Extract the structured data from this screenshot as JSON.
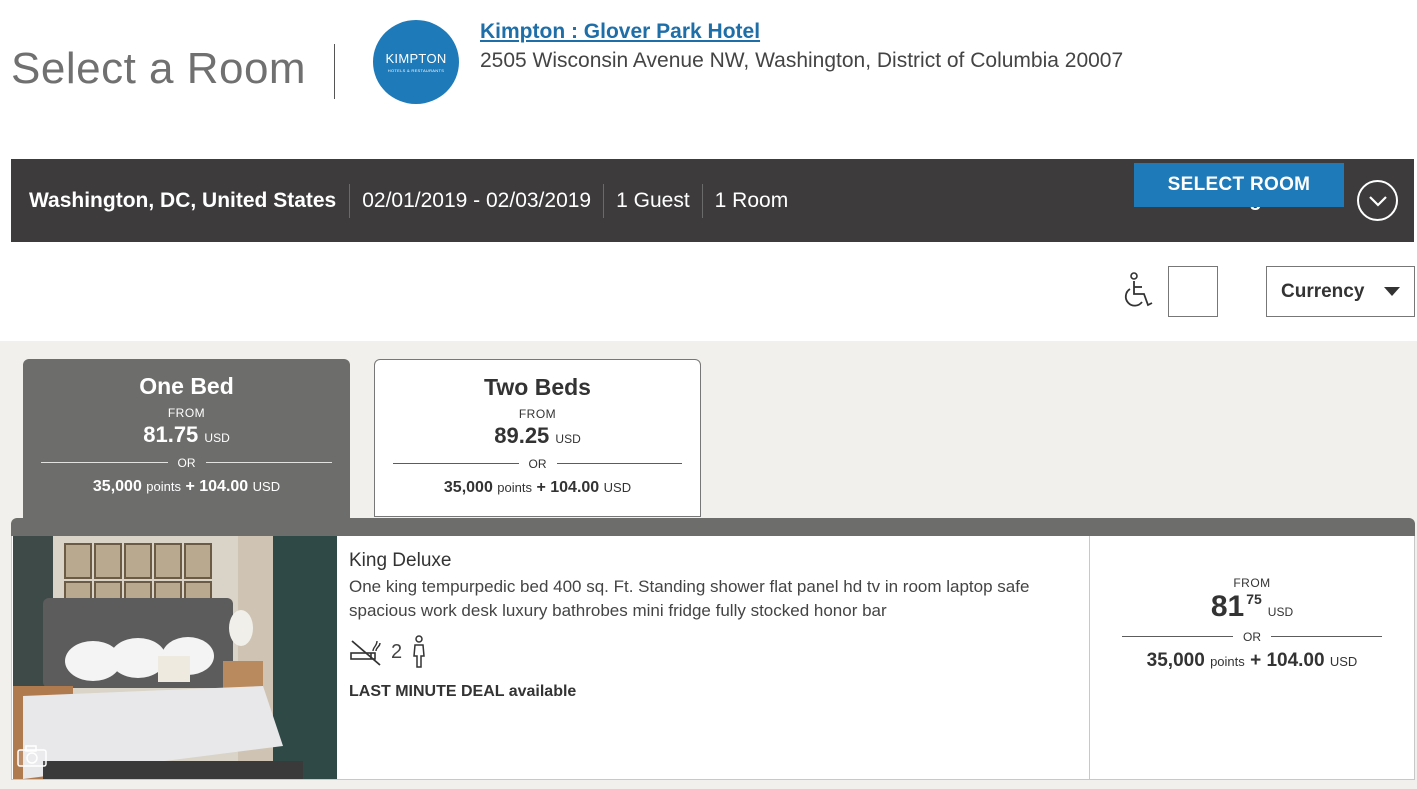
{
  "header": {
    "page_title": "Select a Room",
    "logo_brand": "KIMPTON",
    "logo_sub": "HOTELS & RESTAURANTS",
    "hotel_name": "Kimpton : Glover Park Hotel",
    "hotel_address": "2505 Wisconsin Avenue NW, Washington, District of Columbia 20007"
  },
  "search": {
    "location": "Washington, DC, United States",
    "dates": "02/01/2019 - 02/03/2019",
    "guests": "1 Guest",
    "rooms": "1 Room",
    "change_label": "Change Search"
  },
  "filters": {
    "accessible_icon": "wheelchair-icon",
    "currency_label": "Currency"
  },
  "bed_tabs": [
    {
      "title": "One Bed",
      "from_label": "FROM",
      "price": "81.75",
      "currency": "USD",
      "or_label": "OR",
      "points": "35,000",
      "points_label": "points",
      "plus": "+",
      "cash": "104.00",
      "cash_currency": "USD",
      "active": true
    },
    {
      "title": "Two Beds",
      "from_label": "FROM",
      "price": "89.25",
      "currency": "USD",
      "or_label": "OR",
      "points": "35,000",
      "points_label": "points",
      "plus": "+",
      "cash": "104.00",
      "cash_currency": "USD",
      "active": false
    }
  ],
  "room": {
    "name": "King Deluxe",
    "description": "One king tempurpedic bed 400 sq. Ft. Standing shower flat panel hd tv in room laptop safe spacious work desk luxury bathrobes mini fridge fully stocked honor bar",
    "guest_count": "2",
    "deal": "LAST MINUTE DEAL available",
    "from_label": "FROM",
    "price_whole": "81",
    "price_cents": "75",
    "currency": "USD",
    "or_label": "OR",
    "points": "35,000",
    "points_label": "points",
    "plus": "+",
    "cash": "104.00",
    "cash_currency": "USD",
    "select_label": "SELECT ROOM"
  },
  "colors": {
    "brand_blue": "#1e7ab8",
    "search_bar": "#3d3b3c",
    "active_tab": "#6d6d6b"
  }
}
